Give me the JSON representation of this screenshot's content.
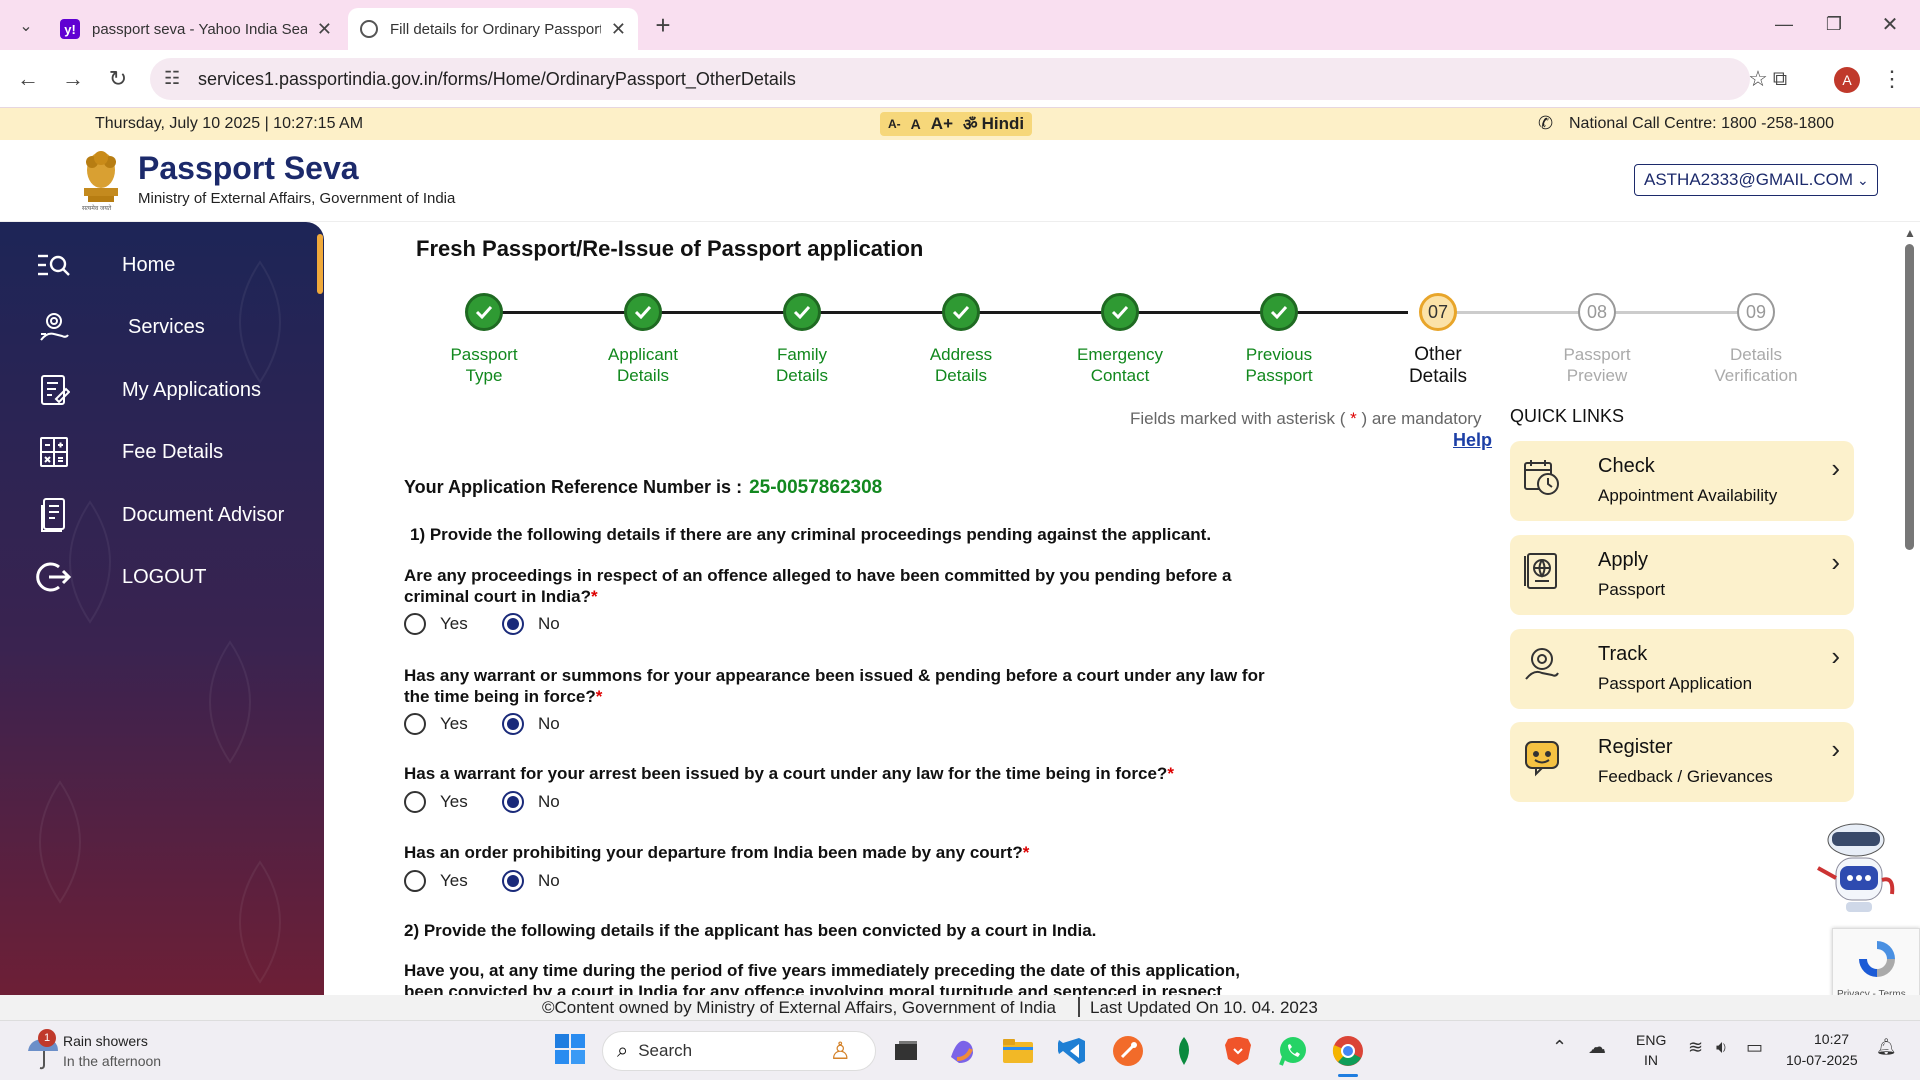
{
  "browser": {
    "tabs": [
      {
        "title": "passport seva - Yahoo India Sea",
        "favicon": "yahoo-icon"
      },
      {
        "title": "Fill details for Ordinary Passport",
        "favicon": "globe-icon"
      }
    ],
    "url": "services1.passportindia.gov.in/forms/Home/OrdinaryPassport_OtherDetails",
    "profile_initial": "A"
  },
  "infobar": {
    "datetime": "Thursday, July 10 2025 | 10:27:15 AM",
    "font_small": "A-",
    "font_normal": "A",
    "font_large": "A+",
    "language": "Hindi",
    "call_centre": "National Call Centre: 1800 -258-1800"
  },
  "header": {
    "title": "Passport Seva",
    "subtitle": "Ministry of External Affairs, Government of India",
    "emblem_text": "सत्यमेव जयते",
    "user": "ASTHA2333@GMAIL.COM"
  },
  "sidebar": {
    "items": [
      {
        "label": "Home",
        "icon": "home-search-icon"
      },
      {
        "label": "Services",
        "icon": "services-icon"
      },
      {
        "label": "My Applications",
        "icon": "applications-icon"
      },
      {
        "label": "Fee Details",
        "icon": "calculator-icon"
      },
      {
        "label": "Document Advisor",
        "icon": "document-icon"
      },
      {
        "label": "LOGOUT",
        "icon": "logout-icon"
      }
    ]
  },
  "page": {
    "title": "Fresh Passport/Re-Issue of Passport application",
    "steps": [
      {
        "line1": "Passport",
        "line2": "Type",
        "state": "done"
      },
      {
        "line1": "Applicant",
        "line2": "Details",
        "state": "done"
      },
      {
        "line1": "Family",
        "line2": "Details",
        "state": "done"
      },
      {
        "line1": "Address",
        "line2": "Details",
        "state": "done"
      },
      {
        "line1": "Emergency",
        "line2": "Contact",
        "state": "done"
      },
      {
        "line1": "Previous",
        "line2": "Passport",
        "state": "done"
      },
      {
        "num": "07",
        "line1": "Other",
        "line2": "Details",
        "state": "current"
      },
      {
        "num": "08",
        "line1": "Passport",
        "line2": "Preview",
        "state": "pending"
      },
      {
        "num": "09",
        "line1": "Details",
        "line2": "Verification",
        "state": "pending"
      }
    ],
    "mandatory_note_pre": "Fields marked with asterisk (",
    "mandatory_star": " * ",
    "mandatory_note_post": ") are mandatory",
    "help": "Help",
    "ref_label": "Your Application Reference Number is :",
    "ref_number": "25-0057862308",
    "section1": "1) Provide the following details if there are any criminal proceedings pending against the applicant.",
    "questions": [
      {
        "text": "Are any proceedings in respect of an offence alleged to have been committed by you pending before a criminal court in India?",
        "yes": "Yes",
        "no": "No",
        "selected": "No"
      },
      {
        "text": "Has any warrant or summons for your appearance been issued & pending before a court under any law for the time being in force?",
        "yes": "Yes",
        "no": "No",
        "selected": "No"
      },
      {
        "text": "Has a warrant for your arrest been issued by a court under any law for the time being in force?",
        "yes": "Yes",
        "no": "No",
        "selected": "No"
      },
      {
        "text": "Has an order prohibiting your departure from India been made by any court?",
        "yes": "Yes",
        "no": "No",
        "selected": "No"
      }
    ],
    "section2": "2) Provide the following details if the applicant has been convicted by a court in India.",
    "question5": "Have you, at any time during the period of five years immediately preceding the date of this application, been convicted by a court in India for any offence involving moral turpitude and sentenced in respect"
  },
  "quick_links": {
    "title": "QUICK LINKS",
    "items": [
      {
        "title": "Check",
        "sub": "Appointment Availability",
        "icon": "calendar-clock-icon"
      },
      {
        "title": "Apply",
        "sub": "Passport",
        "icon": "passport-icon"
      },
      {
        "title": "Track",
        "sub": "Passport Application",
        "icon": "track-icon"
      },
      {
        "title": "Register",
        "sub": "Feedback / Grievances",
        "icon": "feedback-icon"
      }
    ]
  },
  "footer": {
    "text": "©Content owned by Ministry of External Affairs, Government of India",
    "updated": "Last Updated On 10. 04. 2023"
  },
  "recaptcha": {
    "text": "Privacy - Terms"
  },
  "taskbar": {
    "weather_title": "Rain showers",
    "weather_sub": "In the afternoon",
    "weather_badge": "1",
    "search_placeholder": "Search",
    "lang_line1": "ENG",
    "lang_line2": "IN",
    "time": "10:27",
    "date": "10-07-2025"
  }
}
